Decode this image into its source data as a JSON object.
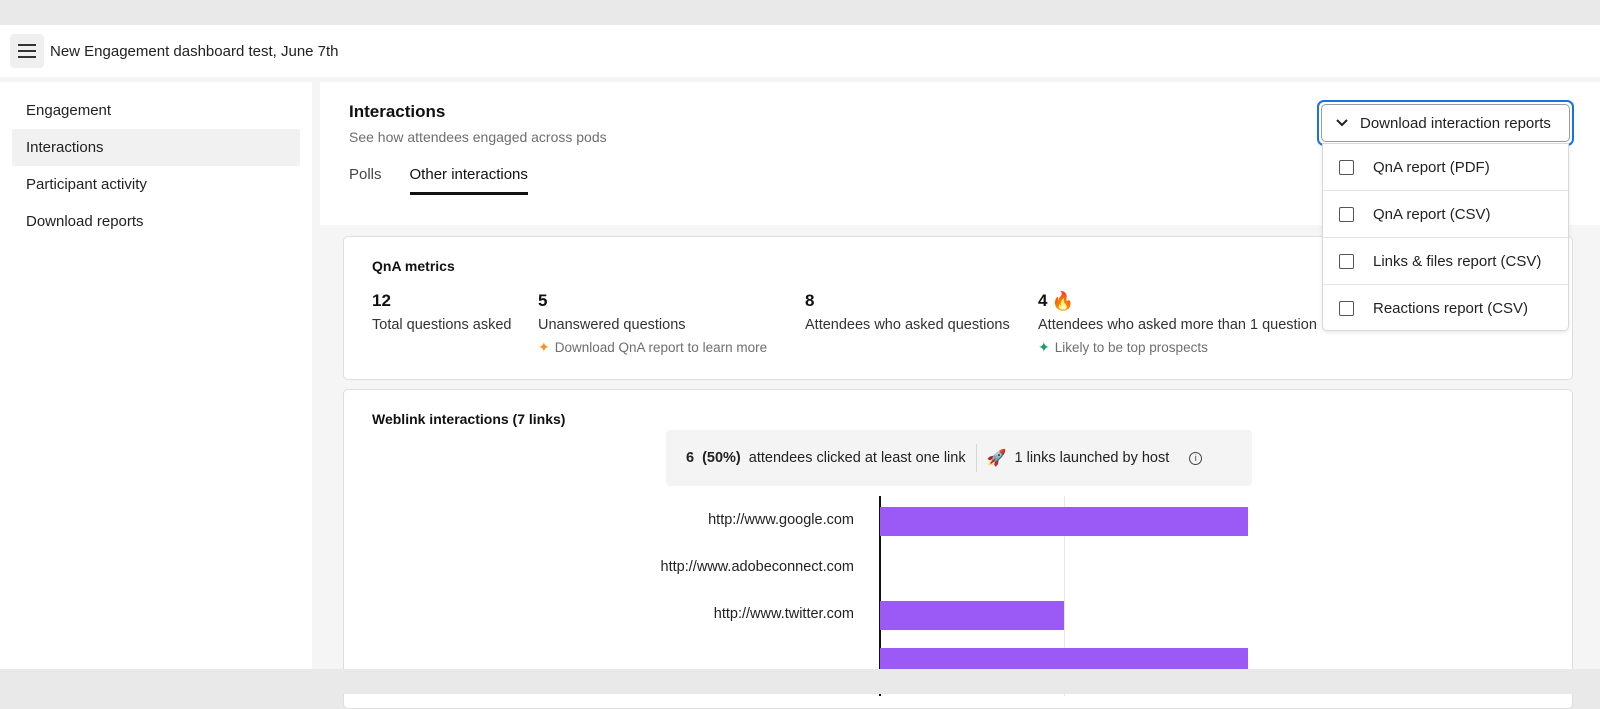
{
  "header": {
    "title": "New Engagement dashboard test, June 7th"
  },
  "sidebar": {
    "items": [
      {
        "label": "Engagement",
        "active": false
      },
      {
        "label": "Interactions",
        "active": true
      },
      {
        "label": "Participant activity",
        "active": false
      },
      {
        "label": "Download reports",
        "active": false
      }
    ]
  },
  "main": {
    "title": "Interactions",
    "subtitle": "See how attendees engaged across pods",
    "tabs": [
      {
        "label": "Polls",
        "active": false
      },
      {
        "label": "Other interactions",
        "active": true
      }
    ]
  },
  "download_menu": {
    "button_label": "Download interaction reports",
    "expanded": true,
    "options": [
      {
        "label": "QnA report (PDF)",
        "checked": false
      },
      {
        "label": "QnA report (CSV)",
        "checked": false
      },
      {
        "label": "Links & files report (CSV)",
        "checked": false
      },
      {
        "label": "Reactions report (CSV)",
        "checked": false
      }
    ]
  },
  "qna_metrics": {
    "title": "QnA metrics",
    "metrics": [
      {
        "value": "12",
        "label": "Total questions asked"
      },
      {
        "value": "5",
        "label": "Unanswered questions",
        "hint": "Download QnA report to learn more",
        "hint_icon": "sparkle-orange",
        "hint_color": "#f29423"
      },
      {
        "value": "8",
        "label": "Attendees who asked questions"
      },
      {
        "value": "4",
        "value_icon": "fire-emoji",
        "label": "Attendees who asked more than 1 question",
        "hint": "Likely to be top prospects",
        "hint_icon": "sparkle-green",
        "hint_color": "#1a9e6b"
      }
    ]
  },
  "weblink": {
    "title": "Weblink interactions (7 links)",
    "summary": {
      "count": "6",
      "percent": "(50%)",
      "clicked_text": "attendees clicked at least one link",
      "launched_icon": "rocket-emoji",
      "launched_text": "1 links launched by host",
      "info_icon": "info-icon"
    }
  },
  "chart_data": {
    "type": "bar",
    "orientation": "horizontal",
    "title": "Weblink interactions (7 links)",
    "categories": [
      "http://www.google.com",
      "http://www.adobeconnect.com",
      "http://www.twitter.com",
      ""
    ],
    "values": [
      2,
      0,
      1,
      2
    ],
    "xlim": [
      0,
      2
    ],
    "grid": true,
    "bar_color": "#9b59f5"
  }
}
